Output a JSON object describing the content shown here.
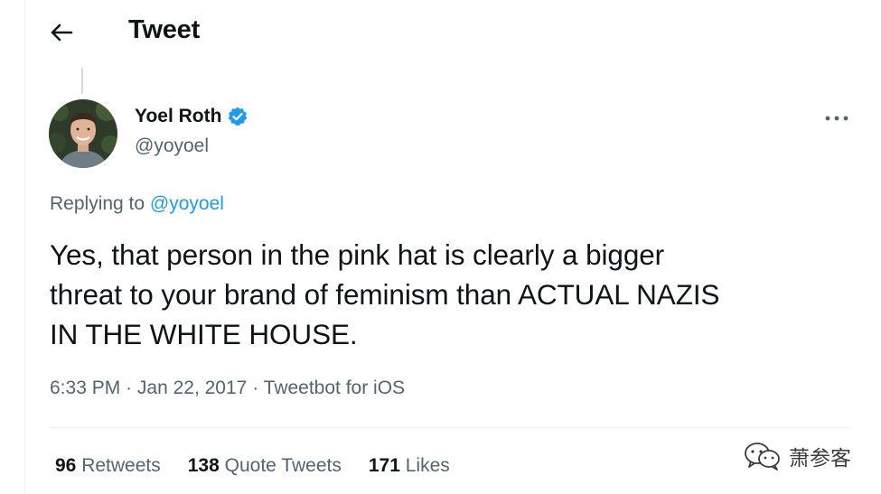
{
  "header": {
    "title": "Tweet",
    "back_icon": "arrow-left-icon"
  },
  "author": {
    "name": "Yoel Roth",
    "handle": "@yoyoel",
    "verified_icon": "verified-badge-icon",
    "verified_color": "#1d9bf0"
  },
  "tweet": {
    "replying_prefix": "Replying to",
    "replying_to": "@yoyoel",
    "text_lines": [
      "Yes, that person in the pink hat is clearly a bigger",
      "threat to your brand of feminism than ACTUAL NAZIS",
      "IN THE WHITE HOUSE."
    ],
    "time": "6:33 PM",
    "date": "Jan 22, 2017",
    "separator": "·",
    "source": "Tweetbot for iOS"
  },
  "stats": {
    "retweets_count": "96",
    "retweets_label": "Retweets",
    "quotes_count": "138",
    "quotes_label": "Quote Tweets",
    "likes_count": "171",
    "likes_label": "Likes"
  },
  "watermark": {
    "icon": "wechat-icon",
    "text": "萧参客"
  },
  "colors": {
    "accent": "#1d9bf0",
    "text_primary": "#0f1419",
    "text_secondary": "#536471",
    "divider": "#eff3f4"
  }
}
